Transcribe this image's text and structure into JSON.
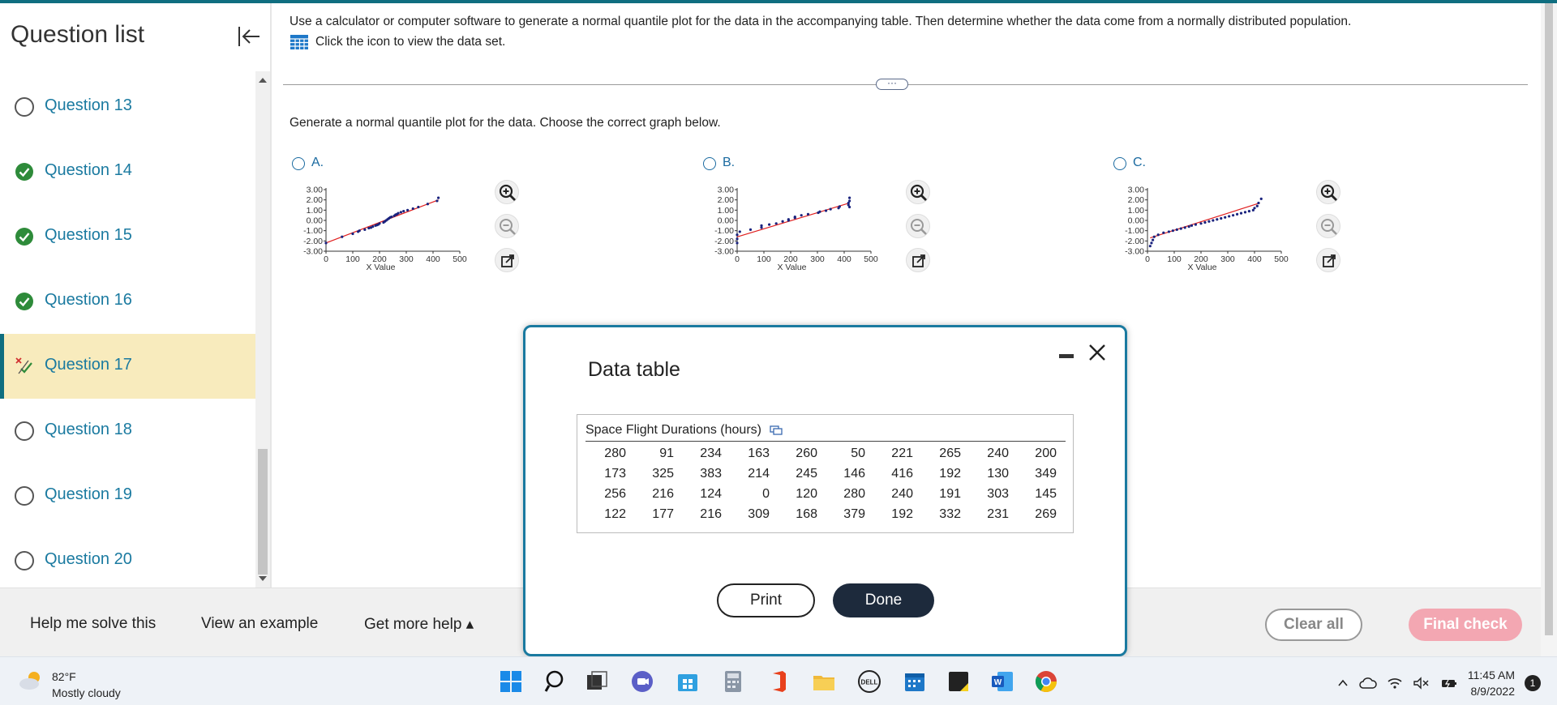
{
  "sidebar": {
    "title": "Question list",
    "items": [
      {
        "label": "Question 13",
        "status": "unanswered"
      },
      {
        "label": "Question 14",
        "status": "correct"
      },
      {
        "label": "Question 15",
        "status": "correct"
      },
      {
        "label": "Question 16",
        "status": "correct"
      },
      {
        "label": "Question 17",
        "status": "partial"
      },
      {
        "label": "Question 18",
        "status": "unanswered"
      },
      {
        "label": "Question 19",
        "status": "unanswered"
      },
      {
        "label": "Question 20",
        "status": "unanswered"
      }
    ]
  },
  "question": {
    "text": "Use a calculator or computer software to generate a normal quantile plot for the data in the accompanying table. Then determine whether the data come from a normally distributed population.",
    "data_link": "Click the icon to view the data set.",
    "instruction": "Generate a normal quantile plot for the data. Choose the correct graph below.",
    "options": [
      {
        "label": "A."
      },
      {
        "label": "B."
      },
      {
        "label": "C."
      }
    ]
  },
  "chart_data": [
    {
      "type": "scatter",
      "xlabel": "X Value",
      "yticks": [
        "3.00",
        "2.00",
        "1.00",
        "0.00",
        "-1.00",
        "-2.00",
        "-3.00"
      ],
      "xticks": [
        "0",
        "100",
        "200",
        "300",
        "400",
        "500"
      ],
      "xlim": [
        0,
        500
      ],
      "ylim": [
        -3,
        3
      ],
      "points": [
        [
          0,
          -2.2
        ],
        [
          60,
          -1.6
        ],
        [
          100,
          -1.3
        ],
        [
          120,
          -1.1
        ],
        [
          125,
          -1.0
        ],
        [
          145,
          -0.9
        ],
        [
          160,
          -0.75
        ],
        [
          168,
          -0.7
        ],
        [
          175,
          -0.6
        ],
        [
          185,
          -0.5
        ],
        [
          190,
          -0.45
        ],
        [
          195,
          -0.4
        ],
        [
          200,
          -0.3
        ],
        [
          215,
          -0.2
        ],
        [
          220,
          -0.1
        ],
        [
          225,
          0.0
        ],
        [
          230,
          0.1
        ],
        [
          235,
          0.2
        ],
        [
          240,
          0.3
        ],
        [
          245,
          0.35
        ],
        [
          255,
          0.45
        ],
        [
          260,
          0.55
        ],
        [
          265,
          0.6
        ],
        [
          270,
          0.7
        ],
        [
          280,
          0.8
        ],
        [
          290,
          0.9
        ],
        [
          305,
          1.0
        ],
        [
          325,
          1.15
        ],
        [
          345,
          1.3
        ],
        [
          380,
          1.6
        ],
        [
          415,
          1.9
        ],
        [
          420,
          2.2
        ]
      ],
      "line": [
        [
          0,
          -2.2
        ],
        [
          420,
          2.0
        ]
      ],
      "line_color": "#e02020",
      "point_color": "#1a237e"
    },
    {
      "type": "scatter",
      "xlabel": "X Value",
      "yticks": [
        "3.00",
        "2.00",
        "1.00",
        "0.00",
        "-1.00",
        "-2.00",
        "-3.00"
      ],
      "xticks": [
        "0",
        "100",
        "200",
        "300",
        "400",
        "500"
      ],
      "xlim": [
        0,
        500
      ],
      "ylim": [
        -3,
        3
      ],
      "points": [
        [
          0,
          -2.2
        ],
        [
          0,
          -1.8
        ],
        [
          0,
          -1.4
        ],
        [
          10,
          -1.1
        ],
        [
          50,
          -0.9
        ],
        [
          91,
          -0.7
        ],
        [
          91,
          -0.5
        ],
        [
          120,
          -0.4
        ],
        [
          146,
          -0.3
        ],
        [
          170,
          -0.1
        ],
        [
          192,
          0.0
        ],
        [
          192,
          0.1
        ],
        [
          216,
          0.25
        ],
        [
          216,
          0.35
        ],
        [
          240,
          0.5
        ],
        [
          265,
          0.6
        ],
        [
          303,
          0.75
        ],
        [
          309,
          0.85
        ],
        [
          332,
          0.95
        ],
        [
          349,
          1.1
        ],
        [
          379,
          1.2
        ],
        [
          383,
          1.35
        ],
        [
          416,
          1.5
        ],
        [
          416,
          1.7
        ],
        [
          420,
          1.9
        ],
        [
          420,
          2.2
        ],
        [
          420,
          1.3
        ]
      ],
      "line": [
        [
          0,
          -1.6
        ],
        [
          420,
          1.7
        ]
      ],
      "line_color": "#e02020",
      "point_color": "#1a237e"
    },
    {
      "type": "scatter",
      "xlabel": "X Value",
      "yticks": [
        "3.00",
        "2.00",
        "1.00",
        "0.00",
        "-1.00",
        "-2.00",
        "-3.00"
      ],
      "xticks": [
        "0",
        "100",
        "200",
        "300",
        "400",
        "500"
      ],
      "xlim": [
        0,
        500
      ],
      "ylim": [
        -3,
        3
      ],
      "points": [
        [
          10,
          -2.5
        ],
        [
          15,
          -2.2
        ],
        [
          20,
          -1.9
        ],
        [
          25,
          -1.6
        ],
        [
          40,
          -1.4
        ],
        [
          60,
          -1.2
        ],
        [
          80,
          -1.1
        ],
        [
          95,
          -1.0
        ],
        [
          110,
          -0.9
        ],
        [
          125,
          -0.8
        ],
        [
          140,
          -0.7
        ],
        [
          155,
          -0.6
        ],
        [
          165,
          -0.5
        ],
        [
          180,
          -0.4
        ],
        [
          200,
          -0.3
        ],
        [
          215,
          -0.2
        ],
        [
          230,
          -0.1
        ],
        [
          245,
          0.0
        ],
        [
          260,
          0.1
        ],
        [
          275,
          0.2
        ],
        [
          290,
          0.3
        ],
        [
          305,
          0.4
        ],
        [
          320,
          0.5
        ],
        [
          335,
          0.6
        ],
        [
          350,
          0.7
        ],
        [
          365,
          0.8
        ],
        [
          380,
          0.9
        ],
        [
          395,
          1.0
        ],
        [
          400,
          1.2
        ],
        [
          410,
          1.4
        ],
        [
          415,
          1.7
        ],
        [
          425,
          2.1
        ]
      ],
      "line": [
        [
          10,
          -1.7
        ],
        [
          420,
          1.7
        ]
      ],
      "line_color": "#e02020",
      "point_color": "#1a237e"
    }
  ],
  "dialog": {
    "title": "Data table",
    "caption": "Space Flight Durations (hours)",
    "rows": [
      [
        "280",
        "91",
        "234",
        "163",
        "260",
        "50",
        "221",
        "265",
        "240",
        "200"
      ],
      [
        "173",
        "325",
        "383",
        "214",
        "245",
        "146",
        "416",
        "192",
        "130",
        "349"
      ],
      [
        "256",
        "216",
        "124",
        "0",
        "120",
        "280",
        "240",
        "191",
        "303",
        "145"
      ],
      [
        "122",
        "177",
        "216",
        "309",
        "168",
        "379",
        "192",
        "332",
        "231",
        "269"
      ]
    ],
    "print_label": "Print",
    "done_label": "Done"
  },
  "bottom": {
    "help_me_solve": "Help me solve this",
    "view_example": "View an example",
    "more_help": "Get more help ▴",
    "clear_all": "Clear all",
    "final_check": "Final check"
  },
  "taskbar": {
    "temperature": "82°F",
    "weather": "Mostly cloudy",
    "time": "11:45 AM",
    "date": "8/9/2022",
    "notifications": "1"
  }
}
